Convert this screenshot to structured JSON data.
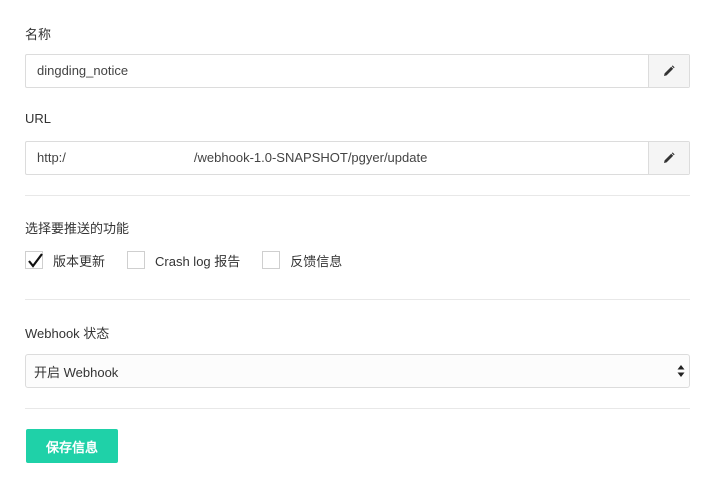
{
  "name_field": {
    "label": "名称",
    "value": "dingding_notice"
  },
  "url_field": {
    "label": "URL",
    "value_prefix": "http:/",
    "value_suffix": "/webhook-1.0-SNAPSHOT/pgyer/update"
  },
  "features": {
    "label": "选择要推送的功能",
    "options": [
      {
        "label": "版本更新",
        "checked": true
      },
      {
        "label": "Crash log 报告",
        "checked": false
      },
      {
        "label": "反馈信息",
        "checked": false
      }
    ]
  },
  "webhook_status": {
    "label": "Webhook 状态",
    "selected": "开启 Webhook"
  },
  "save_button": {
    "label": "保存信息"
  },
  "icons": {
    "edit": "pencil-icon",
    "select": "updown-arrows-icon",
    "check": "checkmark-icon"
  },
  "colors": {
    "accent": "#1fd1a8"
  }
}
